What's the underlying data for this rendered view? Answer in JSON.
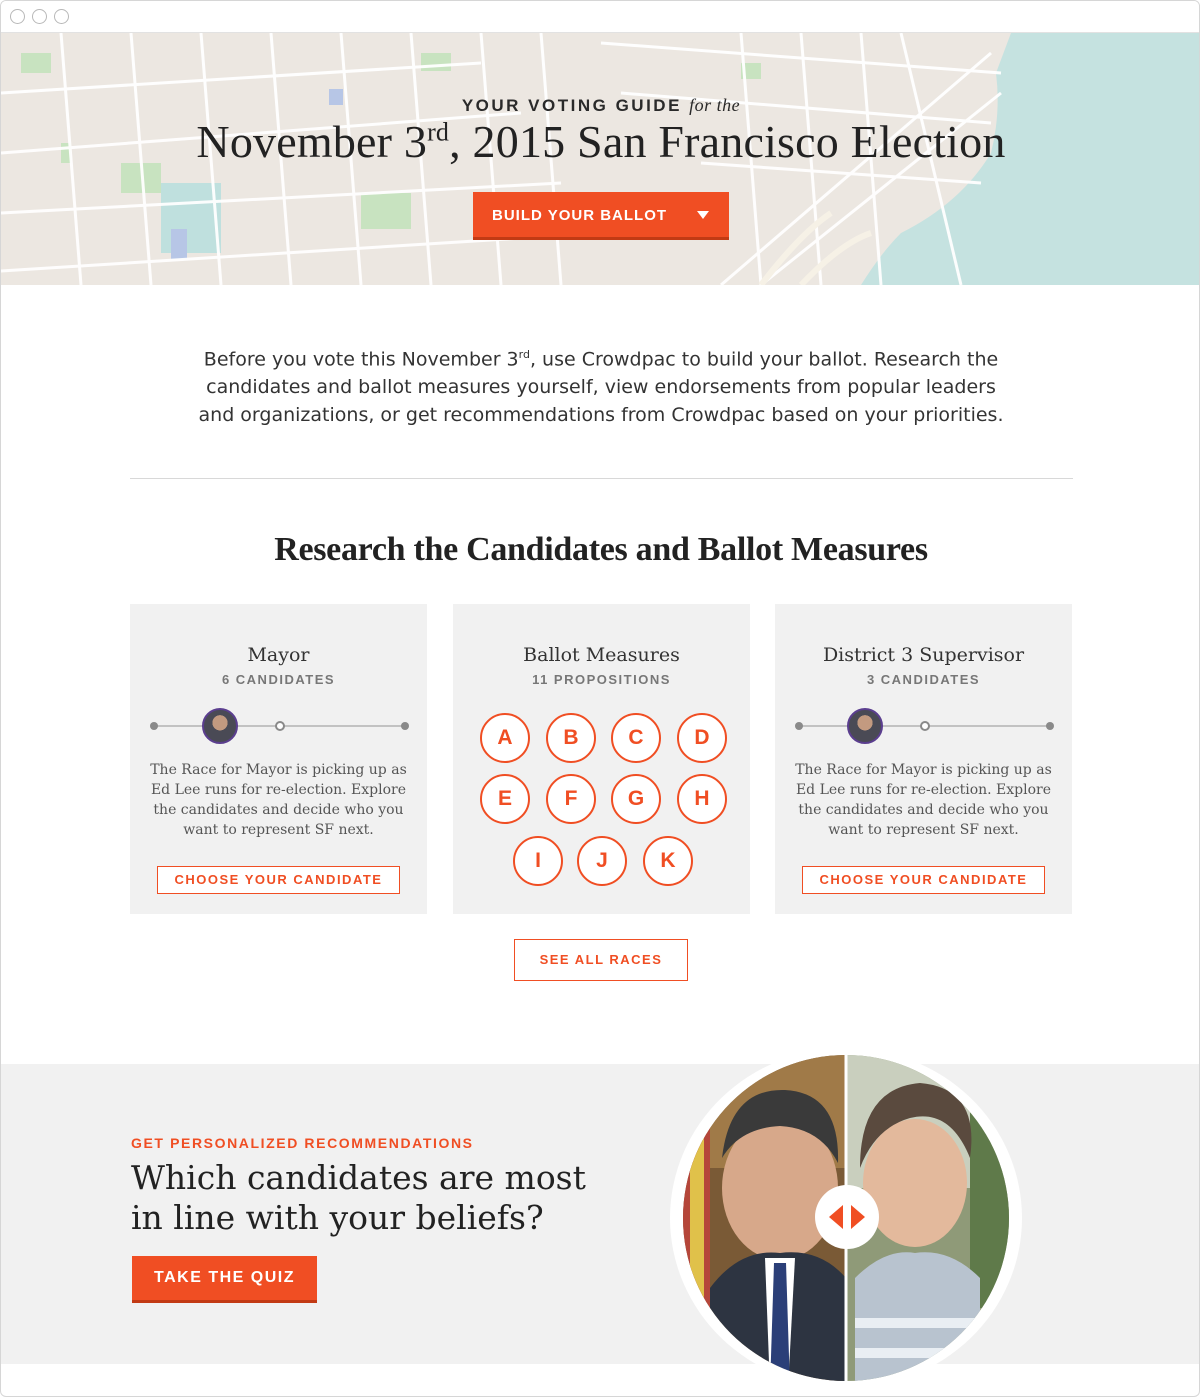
{
  "hero": {
    "kicker": "YOUR VOTING GUIDE",
    "kicker_for": "for the",
    "title_pre": "November 3",
    "title_sup": "rd",
    "title_post": ", 2015 San Francisco Election",
    "build_button": "BUILD YOUR BALLOT"
  },
  "intro": {
    "line1_pre": "Before you vote this November 3",
    "line1_sup": "rd",
    "line1_post": ", use Crowdpac to build your ballot. Research the",
    "line2": "candidates and ballot measures yourself, view endorsements from popular leaders",
    "line3": "and organizations, or get recommendations from Crowdpac based on your priorities."
  },
  "research": {
    "title": "Research the Candidates and Ballot Measures",
    "see_all": "SEE ALL RACES"
  },
  "cards": [
    {
      "title": "Mayor",
      "sub": "6 CANDIDATES",
      "body": "The Race for Mayor is picking up as Ed Lee runs for re-election. Explore the candidates and decide who you want to represent SF next.",
      "button": "CHOOSE YOUR CANDIDATE"
    },
    {
      "title": "Ballot Measures",
      "sub": "11 PROPOSITIONS",
      "props": [
        "A",
        "B",
        "C",
        "D",
        "E",
        "F",
        "G",
        "H",
        "I",
        "J",
        "K"
      ]
    },
    {
      "title": "District 3 Supervisor",
      "sub": "3 CANDIDATES",
      "body": "The Race for Mayor is picking up as Ed Lee runs for re-election. Explore the candidates and decide who you want to represent SF next.",
      "button": "CHOOSE YOUR CANDIDATE"
    }
  ],
  "quiz": {
    "kicker": "GET PERSONALIZED RECOMMENDATIONS",
    "question_line1": "Which candidates are most",
    "question_line2": "in line with your beliefs?",
    "button": "TAKE THE QUIZ"
  },
  "colors": {
    "accent": "#f04e23",
    "map_bg": "#ece7e1",
    "water": "#c5e2e0",
    "card_bg": "#f1f1f1"
  },
  "icons": [
    "caret-down-icon",
    "swap-arrows-icon",
    "candidate-avatar-icon"
  ]
}
